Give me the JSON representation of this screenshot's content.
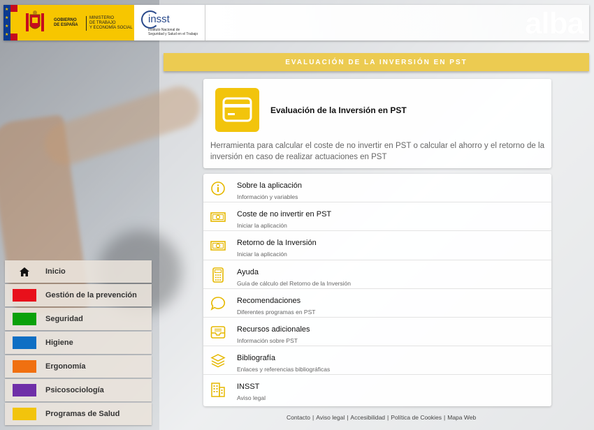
{
  "header": {
    "gov_name_line1": "GOBIERNO",
    "gov_name_line2": "DE ESPAÑA",
    "ministry_line1": "MINISTERIO",
    "ministry_line2": "DE TRABAJO",
    "ministry_line3": "Y ECONOMÍA SOCIAL",
    "insst_name": "insst",
    "insst_sub_line1": "Instituto Nacional de",
    "insst_sub_line2": "Seguridad y Salud en el Trabajo",
    "brand": "alba"
  },
  "titlebar": {
    "label": "EVALUACIÓN DE LA INVERSIÓN EN PST"
  },
  "intro": {
    "title": "Evaluación de la Inversión en PST",
    "description": "Herramienta para calcular el coste de no invertir en PST o calcular el ahorro y el retorno de la inversión en caso de realizar actuaciones en PST"
  },
  "menu": [
    {
      "title": "Sobre la aplicación",
      "subtitle": "Información y variables",
      "icon": "info-icon"
    },
    {
      "title": "Coste de no invertir en PST",
      "subtitle": "Iniciar la aplicación",
      "icon": "money-icon"
    },
    {
      "title": "Retorno de la Inversión",
      "subtitle": "Iniciar la aplicación",
      "icon": "money-icon"
    },
    {
      "title": "Ayuda",
      "subtitle": "Guía de cálculo del Retorno de la Inversión",
      "icon": "calculator-icon"
    },
    {
      "title": "Recomendaciones",
      "subtitle": "Diferentes programas en PST",
      "icon": "chat-icon"
    },
    {
      "title": "Recursos adicionales",
      "subtitle": "Información sobre PST",
      "icon": "inbox-icon"
    },
    {
      "title": "Bibliografía",
      "subtitle": "Enlaces y referencias bibliográficas",
      "icon": "layers-icon"
    },
    {
      "title": "INSST",
      "subtitle": "Aviso legal",
      "icon": "building-icon"
    }
  ],
  "footer": {
    "links": [
      "Contacto",
      "Aviso legal",
      "Accesibilidad",
      "Política de Cookies",
      "Mapa Web"
    ]
  },
  "sidenav": [
    {
      "label": "Inicio",
      "color": ""
    },
    {
      "label": "Gestión de la prevención",
      "color": "#e8101b"
    },
    {
      "label": "Seguridad",
      "color": "#0aa10a"
    },
    {
      "label": "Higiene",
      "color": "#0e6fc4"
    },
    {
      "label": "Ergonomía",
      "color": "#f07010"
    },
    {
      "label": "Psicosociología",
      "color": "#6f2fa8"
    },
    {
      "label": "Programas de Salud",
      "color": "#f2c40c"
    }
  ],
  "colors": {
    "accent": "#f2c40c",
    "titlebar": "#eccb51"
  }
}
